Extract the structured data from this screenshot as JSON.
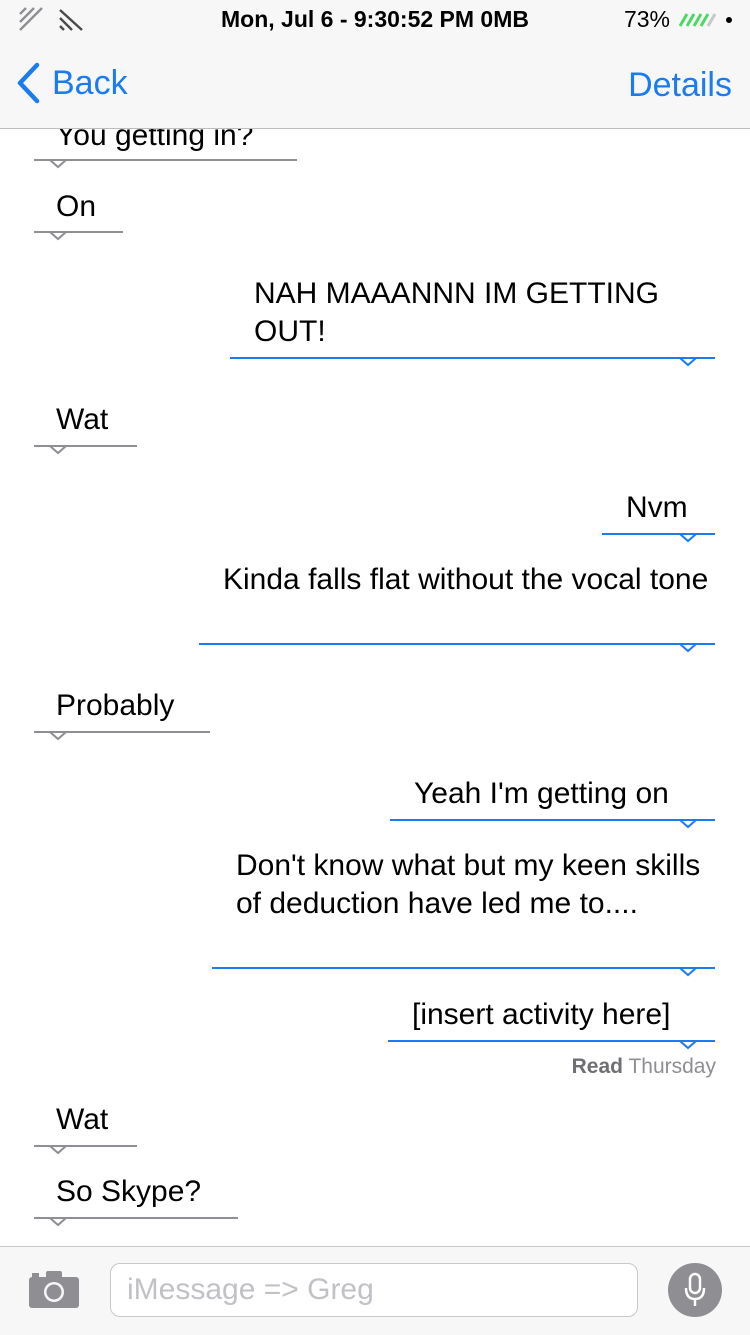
{
  "status_bar": {
    "time": "Mon, Jul 6 - 9:30:52 PM 0MB",
    "battery": "73%"
  },
  "nav": {
    "back_label": "Back",
    "details_label": "Details"
  },
  "messages": [
    {
      "text": "You getting in?",
      "direction": "incoming"
    },
    {
      "text": "On",
      "direction": "incoming"
    },
    {
      "text": "NAH MAAANNN IM GETTING OUT!",
      "direction": "outgoing"
    },
    {
      "text": "Wat",
      "direction": "incoming"
    },
    {
      "text": "Nvm",
      "direction": "outgoing"
    },
    {
      "text": "Kinda falls flat without the vocal tone",
      "direction": "outgoing"
    },
    {
      "text": "Probably",
      "direction": "incoming"
    },
    {
      "text": "Yeah I'm getting on",
      "direction": "outgoing"
    },
    {
      "text": "Don't know what but my keen skills of deduction have led me to....",
      "direction": "outgoing"
    },
    {
      "text": "[insert activity here]",
      "direction": "outgoing"
    },
    {
      "text": "Wat",
      "direction": "incoming"
    },
    {
      "text": "So Skype?",
      "direction": "incoming"
    }
  ],
  "read_receipt": {
    "label": "Read",
    "when": "Thursday"
  },
  "composer": {
    "placeholder": "iMessage => Greg"
  },
  "colors": {
    "accent": "#1a7cf0",
    "incoming_line": "#8e8e93",
    "bar_background": "#f7f7f7"
  },
  "icons": [
    "signal-icon",
    "wifi-icon",
    "battery-icon",
    "back-chevron-icon",
    "camera-icon",
    "microphone-icon"
  ]
}
